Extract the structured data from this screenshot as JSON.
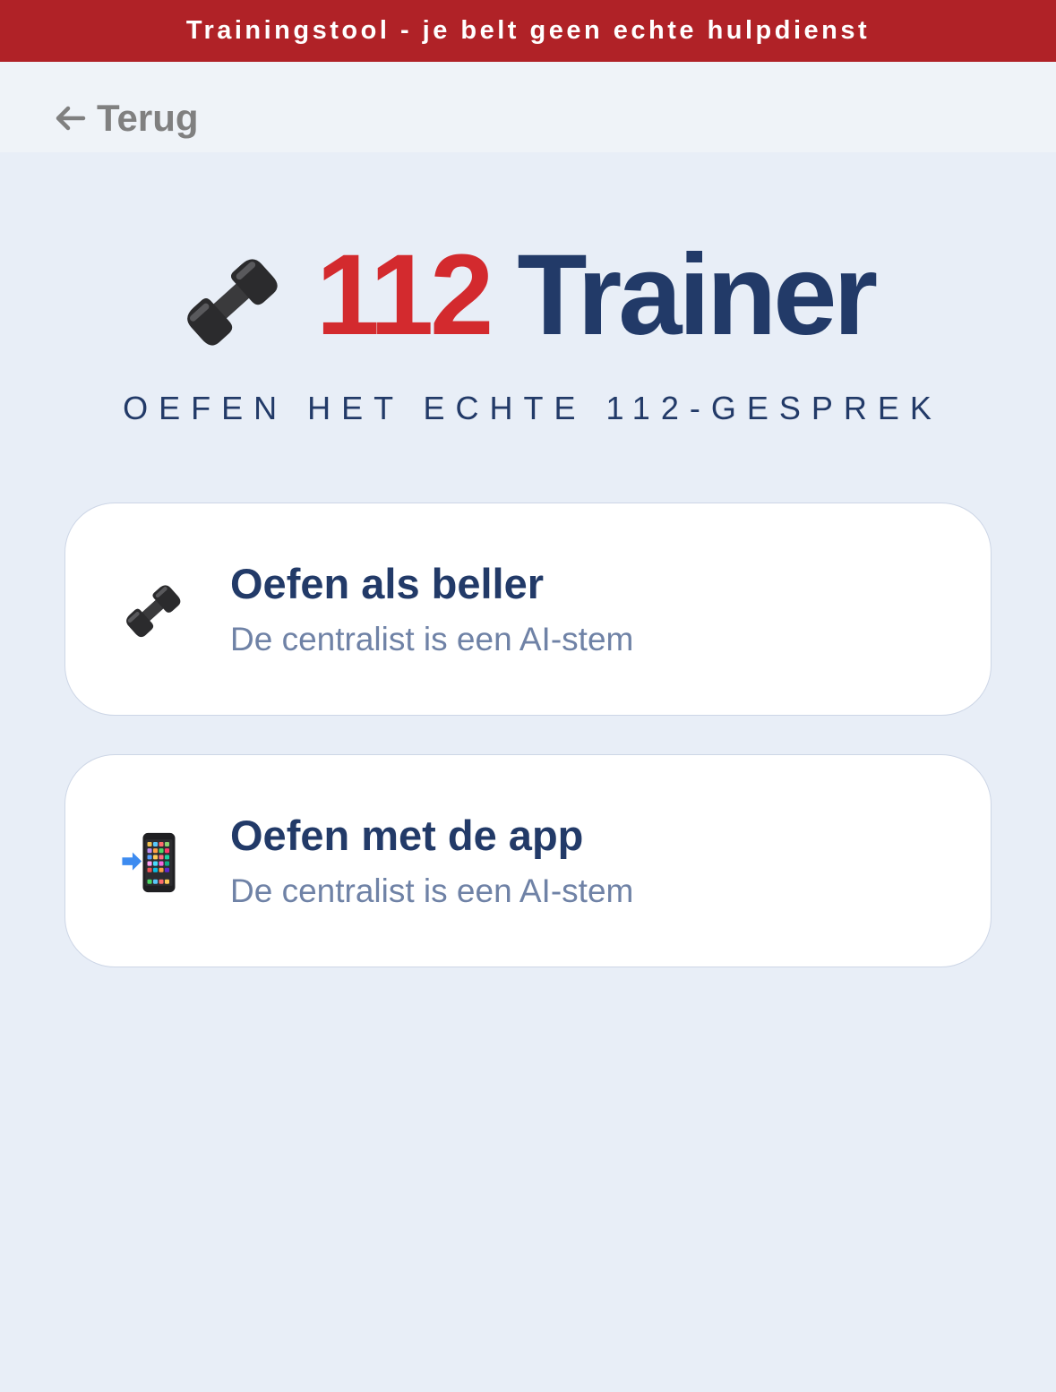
{
  "banner": {
    "text": "Trainingstool - je belt geen echte hulpdienst",
    "color": "#b02227"
  },
  "nav": {
    "back_label": "Terug",
    "back_icon": "arrow-left-icon"
  },
  "hero": {
    "icon": "telephone-receiver-icon",
    "title_number": "112",
    "title_word": "Trainer",
    "number_color": "#d32a2e",
    "word_color": "#223a68"
  },
  "tagline": "OEFEN HET ECHTE 112-GESPREK",
  "options": [
    {
      "icon": "telephone-receiver-icon",
      "title": "Oefen als beller",
      "subtitle": "De centralist is een AI-stem"
    },
    {
      "icon": "mobile-phone-arrow-icon",
      "title": "Oefen met de app",
      "subtitle": "De centralist is een AI-stem"
    }
  ],
  "colors": {
    "background": "#e8eef7",
    "card_background": "#ffffff",
    "subtitle": "#6f82a6",
    "back": "#808080"
  }
}
